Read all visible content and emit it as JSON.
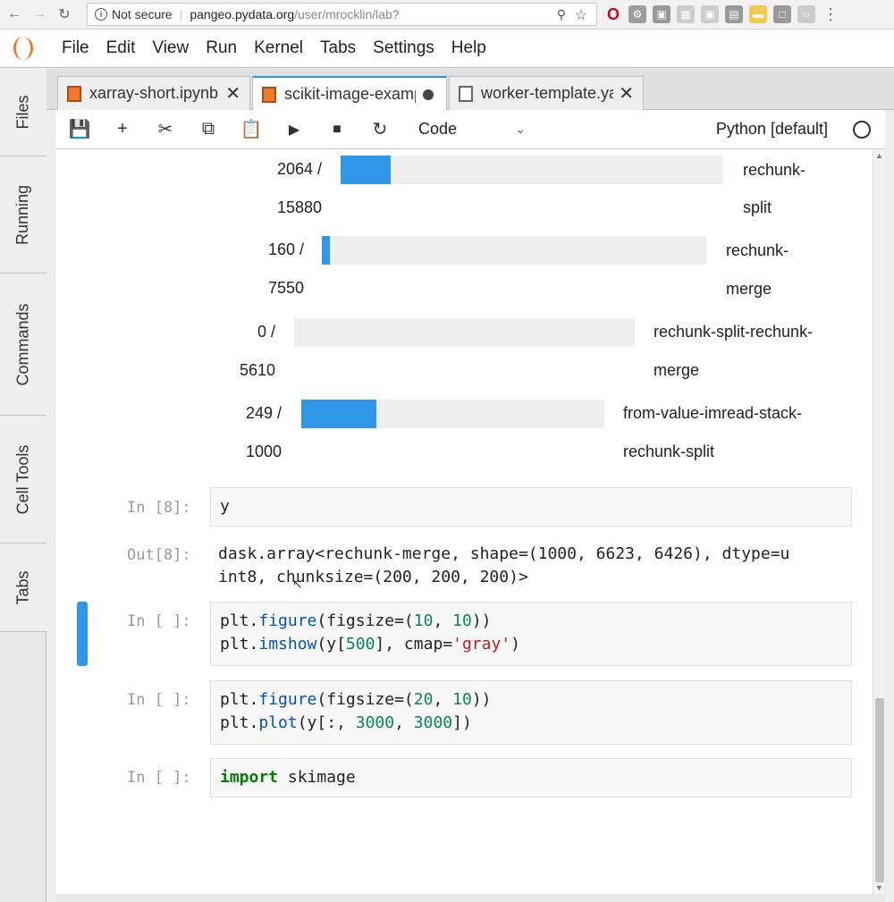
{
  "browser": {
    "not_secure": "Not secure",
    "url_host": "pangeo.pydata.org",
    "url_path": "/user/mrocklin/lab?",
    "icons": [
      "back-icon",
      "forward-icon",
      "reload-icon",
      "info-icon",
      "zoom-icon",
      "star-icon",
      "opera-icon",
      "extension-icon",
      "menu-icon"
    ]
  },
  "menubar": {
    "items": [
      "File",
      "Edit",
      "View",
      "Run",
      "Kernel",
      "Tabs",
      "Settings",
      "Help"
    ]
  },
  "left_sidebar": {
    "tabs": [
      "Files",
      "Running",
      "Commands",
      "Cell Tools",
      "Tabs"
    ]
  },
  "doc_tabs": [
    {
      "label": "xarray-short.ipynb",
      "state": "close"
    },
    {
      "label": "scikit-image-example.ipynb",
      "state": "dirty"
    },
    {
      "label": "worker-template.yaml",
      "state": "close"
    }
  ],
  "toolbar": {
    "icons": [
      "save-icon",
      "add-cell-icon",
      "cut-icon",
      "copy-icon",
      "paste-icon",
      "run-icon",
      "stop-icon",
      "restart-icon"
    ],
    "cell_type": "Code",
    "kernel": "Python [default]"
  },
  "progress": [
    {
      "done": "2064 /",
      "total": "15880",
      "fraction": 0.13,
      "name1": "rechunk-",
      "name2": "split"
    },
    {
      "done": "160 /",
      "total": "7550",
      "fraction": 0.021,
      "name1": "rechunk-",
      "name2": "merge"
    },
    {
      "done": "0 /",
      "total": "5610",
      "fraction": 0.0,
      "name1": "rechunk-split-rechunk-",
      "name2": "merge"
    },
    {
      "done": "249 /",
      "total": "1000",
      "fraction": 0.249,
      "name1": "from-value-imread-stack-",
      "name2": "rechunk-split"
    }
  ],
  "cells": {
    "in8_prompt": "In [8]:",
    "in8_code": "y",
    "out8_prompt": "Out[8]:",
    "out8_line1": "dask.array<rechunk-merge, shape=(1000, 6623, 6426), dtype=u",
    "out8_line2": "int8, chunksize=(200, 200, 200)>",
    "c1_prompt": "In [ ]:",
    "c2_prompt": "In [ ]:",
    "c3_prompt": "In [ ]:",
    "c1": {
      "l1_a": "plt.",
      "l1_fn": "figure",
      "l1_b": "(figsize=(",
      "l1_n1": "10",
      "l1_c": ", ",
      "l1_n2": "10",
      "l1_d": "))",
      "l2_a": "plt.",
      "l2_fn": "imshow",
      "l2_b": "(y[",
      "l2_n": "500",
      "l2_c": "], cmap=",
      "l2_s": "'gray'",
      "l2_d": ")"
    },
    "c2": {
      "l1_a": "plt.",
      "l1_fn": "figure",
      "l1_b": "(figsize=(",
      "l1_n1": "20",
      "l1_c": ", ",
      "l1_n2": "10",
      "l1_d": "))",
      "l2_a": "plt.",
      "l2_fn": "plot",
      "l2_b": "(y[:, ",
      "l2_n1": "3000",
      "l2_c": ", ",
      "l2_n2": "3000",
      "l2_d": "])"
    },
    "c3": {
      "kw": "import",
      "rest": " skimage"
    }
  },
  "colors": {
    "accent": "#2196f3",
    "progress": "#2e97e8",
    "jupyter_orange": "#f37726"
  }
}
